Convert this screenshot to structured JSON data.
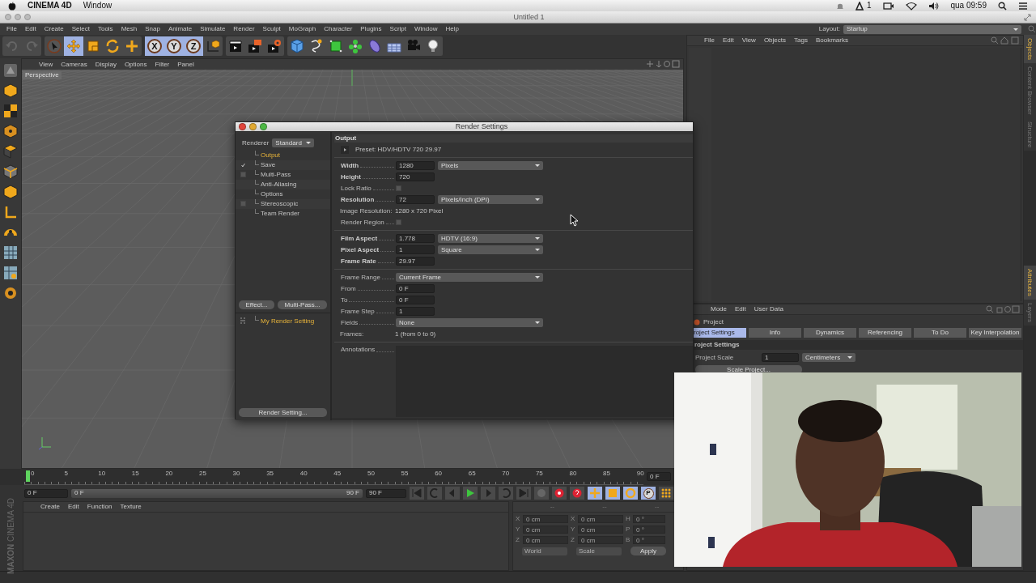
{
  "system_bar": {
    "app": "CINEMA 4D",
    "menus": [
      "Window"
    ],
    "badge": "1",
    "clock": "qua 09:59"
  },
  "window": {
    "title": "Untitled 1"
  },
  "menu": [
    "File",
    "Edit",
    "Create",
    "Select",
    "Tools",
    "Mesh",
    "Snap",
    "Animate",
    "Simulate",
    "Render",
    "Sculpt",
    "MoGraph",
    "Character",
    "Plugins",
    "Script",
    "Window",
    "Help"
  ],
  "layout": {
    "label": "Layout:",
    "value": "Startup"
  },
  "toolbar": [
    [
      {
        "kind": "undo",
        "selected": false
      },
      {
        "kind": "redo",
        "selected": false
      }
    ],
    [
      {
        "kind": "select",
        "selected": false
      },
      {
        "kind": "move",
        "selected": true
      },
      {
        "kind": "scale",
        "selected": false
      },
      {
        "kind": "rotate",
        "selected": false
      },
      {
        "kind": "add",
        "selected": false
      }
    ],
    [
      {
        "kind": "axis",
        "label": "X",
        "selected": true
      },
      {
        "kind": "axis",
        "label": "Y",
        "selected": true
      },
      {
        "kind": "axis",
        "label": "Z",
        "selected": true
      },
      {
        "kind": "coord",
        "selected": false
      }
    ],
    [
      {
        "kind": "render-view",
        "selected": false
      },
      {
        "kind": "render",
        "selected": false
      },
      {
        "kind": "render-settings",
        "selected": false
      }
    ],
    [
      {
        "kind": "cube",
        "selected": false
      },
      {
        "kind": "pen",
        "selected": false
      },
      {
        "kind": "subdivide",
        "selected": false
      },
      {
        "kind": "cloner",
        "selected": false
      },
      {
        "kind": "deformer",
        "selected": false
      },
      {
        "kind": "floor",
        "selected": false
      },
      {
        "kind": "camera",
        "selected": false
      },
      {
        "kind": "light",
        "selected": false
      }
    ]
  ],
  "viewport": {
    "menu": [
      "View",
      "Cameras",
      "Display",
      "Options",
      "Filter",
      "Panel"
    ],
    "label": "Perspective"
  },
  "objects_panel": {
    "menu": [
      "File",
      "Edit",
      "View",
      "Objects",
      "Tags",
      "Bookmarks"
    ]
  },
  "side_tabs_top": [
    {
      "label": "Objects",
      "selected": true
    },
    {
      "label": "Content Browser",
      "selected": false
    },
    {
      "label": "Structure",
      "selected": false
    }
  ],
  "attributes": {
    "menu": [
      "Mode",
      "Edit",
      "User Data"
    ],
    "object": "Project",
    "tabs": [
      {
        "label": "roject Settings",
        "selected": true
      },
      {
        "label": "Info",
        "selected": false
      },
      {
        "label": "Dynamics",
        "selected": false
      },
      {
        "label": "Referencing",
        "selected": false
      },
      {
        "label": "To Do",
        "selected": false
      },
      {
        "label": "Key Interpolation",
        "selected": false
      }
    ],
    "section": "roject Settings",
    "field": {
      "label": "Project Scale",
      "value": "1",
      "unit": "Centimeters"
    },
    "button": "Scale Project..."
  },
  "side_tabs_bottom": [
    {
      "label": "Attributes",
      "selected": true
    },
    {
      "label": "Layers",
      "selected": false
    }
  ],
  "timeline": {
    "ticks": [
      "0",
      "5",
      "10",
      "15",
      "20",
      "25",
      "30",
      "35",
      "40",
      "45",
      "50",
      "55",
      "60",
      "65",
      "70",
      "75",
      "80",
      "85",
      "90"
    ],
    "current": "0 F",
    "level": 0
  },
  "transport": {
    "start": "0 F",
    "range": {
      "start": "0 F",
      "end": "90 F",
      "level": 1
    },
    "end": "90 F",
    "point_button": "P"
  },
  "materials": {
    "menu": [
      "Create",
      "Edit",
      "Function",
      "Texture"
    ]
  },
  "logo": {
    "brand": "MAXON",
    "product": "CINEMA 4D"
  },
  "coordinates": {
    "headers": [
      "--",
      "--",
      "--"
    ],
    "rows": [
      {
        "axis": "X",
        "position": "0 cm",
        "size_axis": "X",
        "size": "0 cm",
        "rot_axis": "H",
        "rotation": "0 °"
      },
      {
        "axis": "Y",
        "position": "0 cm",
        "size_axis": "Y",
        "size": "0 cm",
        "rot_axis": "P",
        "rotation": "0 °"
      },
      {
        "axis": "Z",
        "position": "0 cm",
        "size_axis": "Z",
        "size": "0 cm",
        "rot_axis": "B",
        "rotation": "0 °"
      }
    ],
    "mode": "World",
    "size_mode": "Scale",
    "apply": "Apply"
  },
  "render_settings": {
    "title": "Render Settings",
    "renderer": {
      "label": "Renderer",
      "value": "Standard"
    },
    "nav": [
      {
        "label": "Output",
        "kind": "plain",
        "selected": true
      },
      {
        "label": "Save",
        "kind": "checkbox",
        "checked": true,
        "selected": false
      },
      {
        "label": "Multi-Pass",
        "kind": "checkbox",
        "checked": false,
        "selected": false
      },
      {
        "label": "Anti-Aliasing",
        "kind": "plain",
        "selected": false
      },
      {
        "label": "Options",
        "kind": "plain",
        "selected": false
      },
      {
        "label": "Stereoscopic",
        "kind": "checkbox",
        "checked": false,
        "selected": false
      },
      {
        "label": "Team Render",
        "kind": "plain",
        "selected": false
      }
    ],
    "buttons": [
      "Effect...",
      "Multi-Pass..."
    ],
    "settings": [
      {
        "label": "My Render Setting",
        "selected": true
      }
    ],
    "footer_button": "Render Setting...",
    "section": "Output",
    "preset": "Preset: HDV/HDTV 720 29.97",
    "groups": [
      [
        {
          "kind": "number",
          "label": "Width",
          "value": "1280",
          "unit": "Pixels",
          "bold": true
        },
        {
          "kind": "number",
          "label": "Height",
          "value": "720",
          "bold": true
        },
        {
          "kind": "checkbox",
          "label": "Lock Ratio",
          "checked": false
        },
        {
          "kind": "number",
          "label": "Resolution",
          "value": "72",
          "unit": "Pixels/Inch (DPI)",
          "bold": true
        },
        {
          "kind": "info",
          "label": "Image Resolution:",
          "value": "1280 x 720 Pixel"
        },
        {
          "kind": "checkbox",
          "label": "Render Region",
          "checked": false
        }
      ],
      [
        {
          "kind": "number",
          "label": "Film Aspect",
          "value": "1.778",
          "unit": "HDTV (16:9)",
          "bold": true
        },
        {
          "kind": "number",
          "label": "Pixel Aspect",
          "value": "1",
          "unit": "Square",
          "bold": true
        },
        {
          "kind": "number",
          "label": "Frame Rate",
          "value": "29.97",
          "bold": true
        }
      ],
      [
        {
          "kind": "dropdown",
          "label": "Frame Range",
          "value": "Current Frame"
        },
        {
          "kind": "number",
          "label": "From",
          "value": "0 F",
          "bold": false
        },
        {
          "kind": "number",
          "label": "To",
          "value": "0 F",
          "bold": false
        },
        {
          "kind": "number",
          "label": "Frame Step",
          "value": "1",
          "bold": false
        },
        {
          "kind": "dropdown",
          "label": "Fields",
          "value": "None"
        },
        {
          "kind": "info",
          "label": "Frames:",
          "value": "1 (from 0 to 0)"
        }
      ],
      [
        {
          "kind": "textarea",
          "label": "Annotations"
        }
      ]
    ]
  },
  "webcam": {
    "kind": "picture"
  }
}
